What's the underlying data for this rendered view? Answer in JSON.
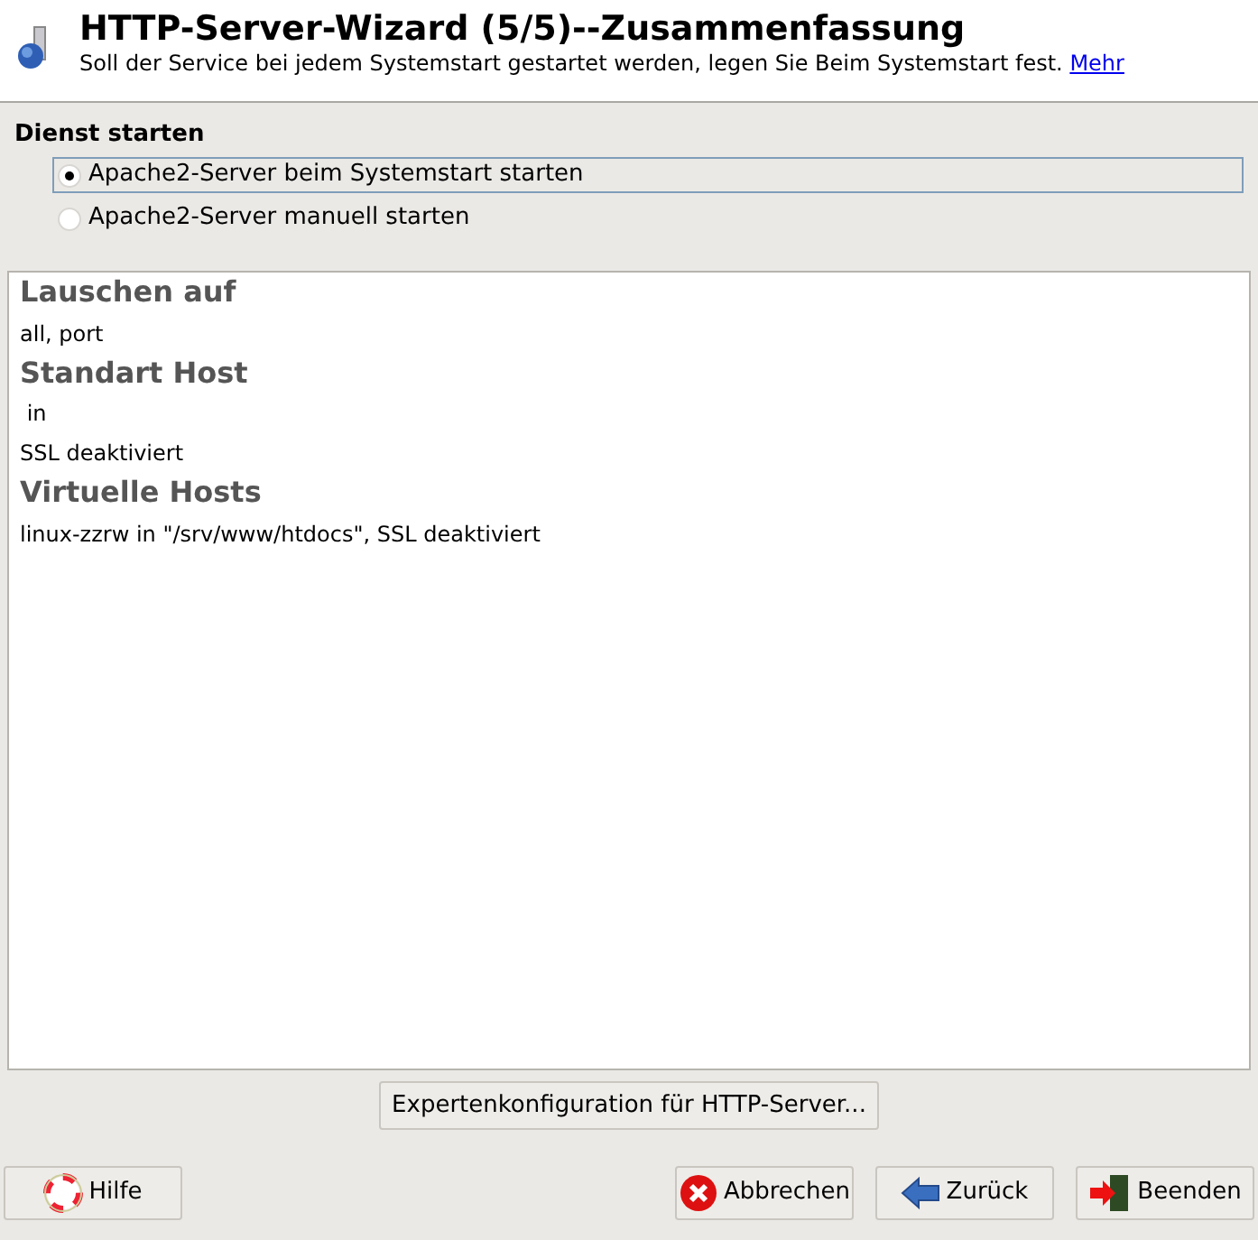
{
  "header": {
    "title": "HTTP-Server-Wizard (5/5)--Zusammenfassung",
    "description": "Soll der Service bei jedem Systemstart gestartet werden, legen Sie Beim Systemstart fest.",
    "link": "Mehr"
  },
  "start_group": {
    "label": "Dienst starten",
    "options": [
      {
        "label": "Apache2-Server beim Systemstart starten",
        "selected": true
      },
      {
        "label": "Apache2-Server manuell starten",
        "selected": false
      }
    ]
  },
  "summary": [
    {
      "kind": "heading",
      "text": "Lauschen auf"
    },
    {
      "kind": "text",
      "text": "all, port"
    },
    {
      "kind": "heading",
      "text": "Standart Host"
    },
    {
      "kind": "text",
      "text": " in"
    },
    {
      "kind": "text",
      "text": "SSL deaktiviert"
    },
    {
      "kind": "heading",
      "text": "Virtuelle Hosts"
    },
    {
      "kind": "text",
      "text": "linux-zzrw in \"/srv/www/htdocs\", SSL deaktiviert"
    }
  ],
  "expert_button": "Expertenkonfiguration für HTTP-Server...",
  "buttons": [
    {
      "kind": "help",
      "label": "Hilfe"
    },
    {
      "kind": "abort",
      "label": "Abbrechen"
    },
    {
      "kind": "back",
      "label": "Zurück"
    },
    {
      "kind": "finish",
      "label": "Beenden"
    }
  ]
}
